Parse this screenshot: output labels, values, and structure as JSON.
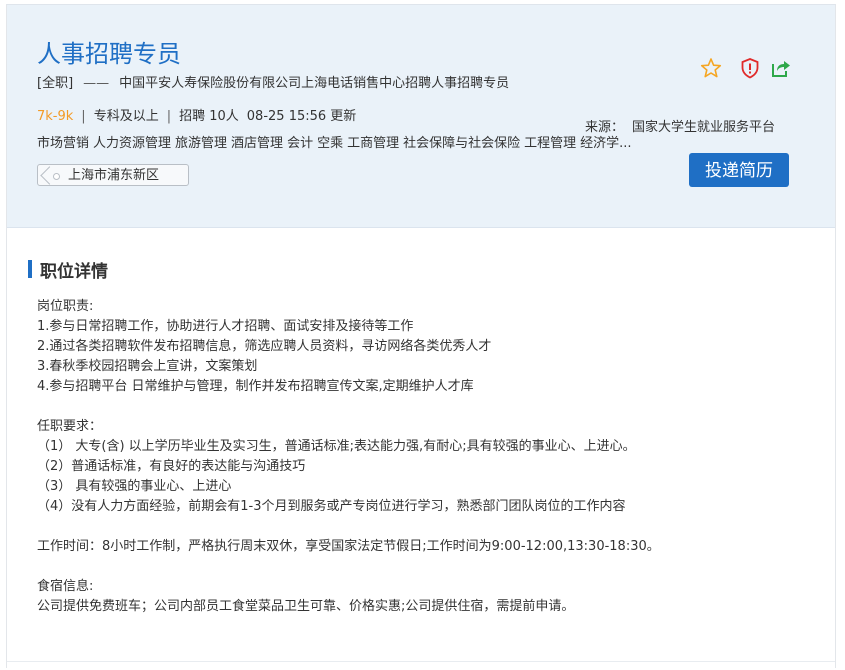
{
  "job": {
    "title": "人事招聘专员",
    "subtitle_type": "[全职]",
    "subtitle_dash": "——",
    "subtitle_company": "中国平安人寿保险股份有限公司上海电话销售中心招聘人事招聘专员",
    "salary": "7k-9k",
    "education": "专科及以上",
    "headcount": "招聘 10人",
    "updated": "08-25 15:56 更新",
    "separator": "|",
    "tags": [
      "市场营销",
      "人力资源管理",
      "旅游管理",
      "酒店管理",
      "会计",
      "空乘",
      "工商管理",
      "社会保障与社会保险",
      "工程管理",
      "经济学..."
    ],
    "location": "上海市浦东新区",
    "source_label": "来源：",
    "source_value": "国家大学生就业服务平台",
    "apply_label": "投递简历"
  },
  "icons": {
    "favorite": "star-icon",
    "report": "shield-icon",
    "share": "share-icon",
    "colors": {
      "star": "#f5a623",
      "shield": "#e02b2b",
      "share": "#2ea84a"
    }
  },
  "detail": {
    "section_title": "职位详情",
    "lines": [
      "岗位职责:",
      "1.参与日常招聘工作，协助进行人才招聘、面试安排及接待等工作",
      "2.通过各类招聘软件发布招聘信息，筛选应聘人员资料，寻访网络各类优秀人才",
      "3.春秋季校园招聘会上宣讲，文案策划",
      "4.参与招聘平台 日常维护与管理，制作并发布招聘宣传文案,定期维护人才库",
      "",
      "任职要求：",
      "（1） 大专(含) 以上学历毕业生及实习生，普通话标准;表达能力强,有耐心;具有较强的事业心、上进心。",
      "（2）普通话标准，有良好的表达能与沟通技巧",
      "（3） 具有较强的事业心、上进心",
      "（4）没有人力方面经验，前期会有1-3个月到服务或产专岗位进行学习，熟悉部门团队岗位的工作内容",
      "",
      "工作时间：8小时工作制，严格执行周末双休，享受国家法定节假日;工作时间为9:00-12:00,13:30-18:30。",
      "",
      "食宿信息:",
      "公司提供免费班车；公司内部员工食堂菜品卫生可靠、价格实惠;公司提供住宿，需提前申请。"
    ]
  },
  "colors": {
    "accent": "#1f6fc5",
    "salary": "#f39b27",
    "header_bg": "#eaf2f9"
  }
}
